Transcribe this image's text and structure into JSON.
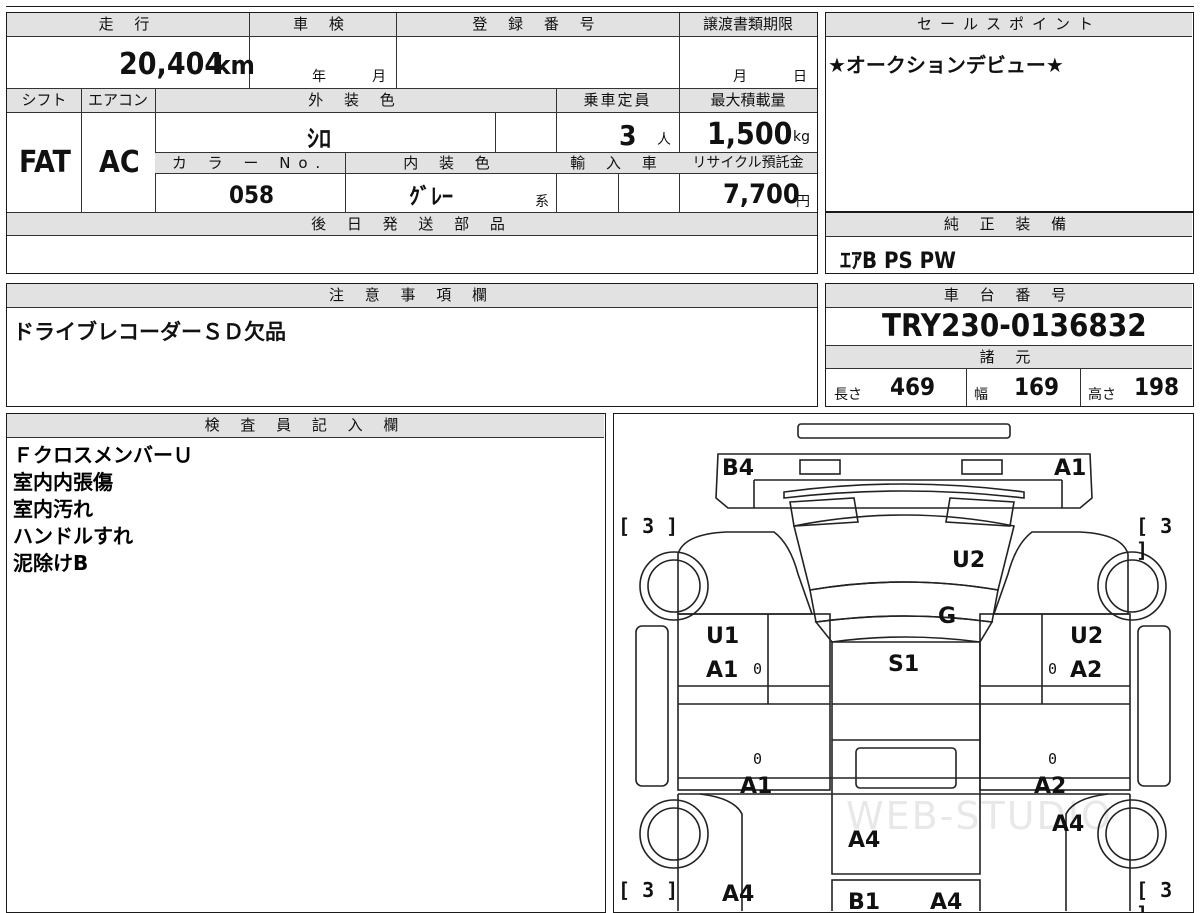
{
  "header": {
    "mileage_label": "走 行",
    "mileage_value": "20,404",
    "mileage_unit": "km",
    "inspection_label": "車 検",
    "inspection_year": "年",
    "inspection_month": "月",
    "registration_label": "登 録 番 号",
    "transfer_label": "譲渡書類期限",
    "transfer_month": "月",
    "transfer_day": "日"
  },
  "specs": {
    "shift_label": "シフト",
    "shift_value": "FAT",
    "ac_label": "エアコン",
    "ac_value": "AC",
    "exterior_label": "外 装 色",
    "exterior_value": "ｼﾛ",
    "capacity_label": "乗車定員",
    "capacity_value": "3",
    "capacity_unit": "人",
    "load_label": "最大積載量",
    "load_value": "1,500",
    "load_unit": "kg",
    "color_no_label": "カ ラ ー No.",
    "color_no_value": "058",
    "interior_label": "内 装 色",
    "interior_value": "ｸﾞﾚｰ",
    "interior_suffix": "系",
    "import_label": "輸 入 車",
    "recycle_label": "リサイクル預託金",
    "recycle_value": "7,700",
    "recycle_unit": "円"
  },
  "later_parts": {
    "label": "後 日 発 送 部 品",
    "value": ""
  },
  "sales": {
    "label": "セールスポイント",
    "value": "★オークションデビュー★"
  },
  "genuine": {
    "label": "純 正 装 備",
    "value": "ｴｱB PS PW"
  },
  "caution": {
    "label": "注 意 事 項 欄",
    "value": "ドライブレコーダーＳＤ欠品"
  },
  "chassis": {
    "label": "車 台 番 号",
    "value": "TRY230-0136832",
    "specs_label": "諸 元",
    "length_label": "長さ",
    "length_value": "469",
    "width_label": "幅",
    "width_value": "169",
    "height_label": "高さ",
    "height_value": "198"
  },
  "inspector": {
    "label": "検 査 員 記 入 欄",
    "lines": [
      "ＦクロスメンバーＵ",
      "室内内張傷",
      "室内汚れ",
      "ハンドルすれ",
      "泥除けB"
    ]
  },
  "diagram": {
    "labels": [
      "B4",
      "A1",
      "U2",
      "G",
      "U1",
      "A1",
      "S1",
      "U2",
      "A2",
      "A1",
      "A2",
      "A4",
      "A4",
      "A4",
      "B1",
      "A4"
    ],
    "tire_marks": [
      "[ 3 ]",
      "[ 3 ]",
      "[ 3 ]",
      "[ 3 ]"
    ],
    "zeros": [
      "0",
      "0",
      "0",
      "0"
    ],
    "watermark": "WEB-STUDIO"
  }
}
